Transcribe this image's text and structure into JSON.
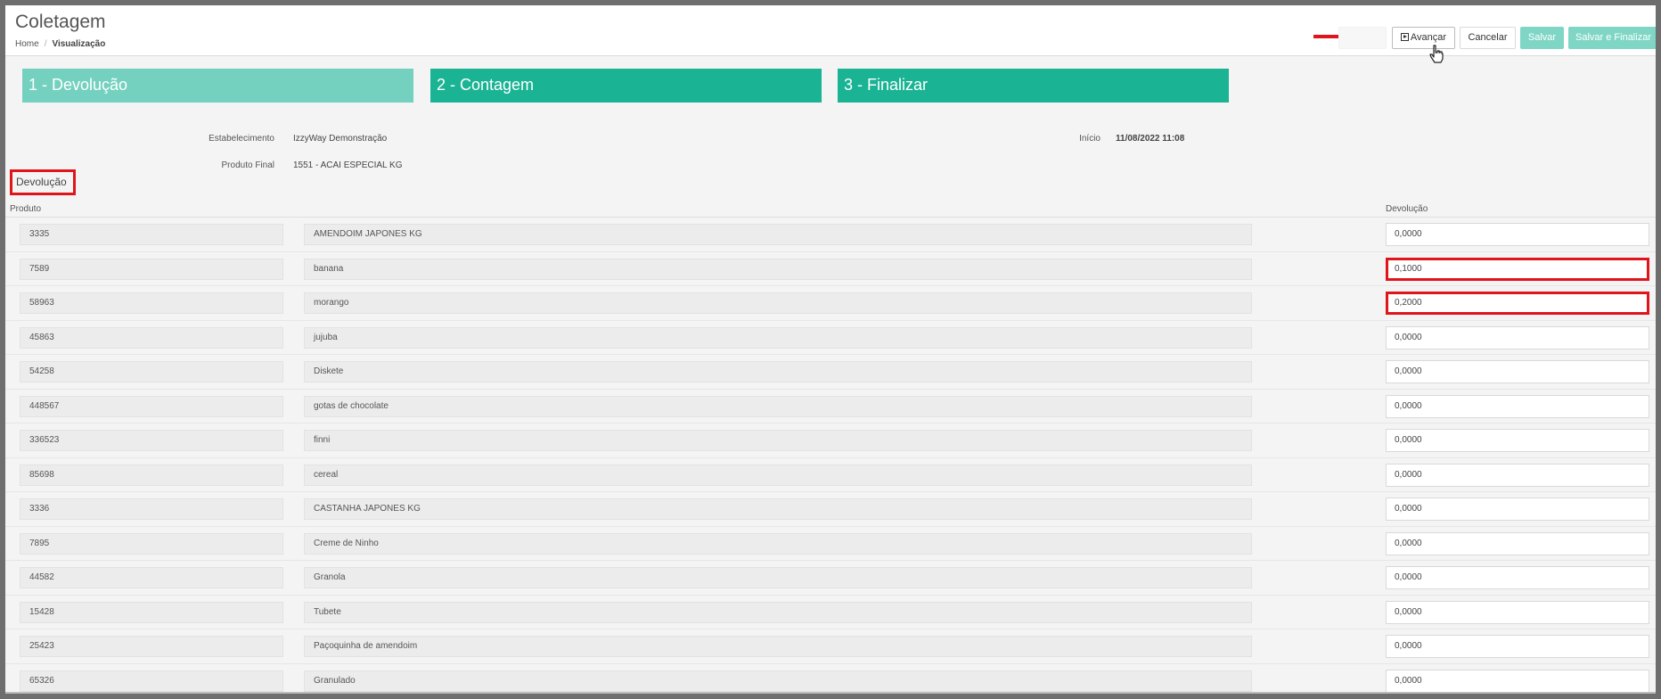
{
  "header": {
    "title": "Coletagem",
    "breadcrumb": {
      "home": "Home",
      "separator": "/",
      "current": "Visualização"
    },
    "buttons": {
      "avancar": "Avançar",
      "cancelar": "Cancelar",
      "salvar": "Salvar",
      "salvar_finalizar": "Salvar e Finalizar"
    }
  },
  "steps": [
    {
      "label": "1 - Devolução",
      "state": "current"
    },
    {
      "label": "2 - Contagem",
      "state": "pending"
    },
    {
      "label": "3 - Finalizar",
      "state": "pending"
    }
  ],
  "info": {
    "estabelecimento_label": "Estabelecimento",
    "estabelecimento_value": "IzzyWay Demonstração",
    "inicio_label": "Início",
    "inicio_value": "11/08/2022 11:08",
    "produto_final_label": "Produto Final",
    "produto_final_value": "1551 - ACAI ESPECIAL KG"
  },
  "section": {
    "title": "Devolução",
    "col_produto": "Produto",
    "col_devolucao": "Devolução"
  },
  "rows": [
    {
      "code": "3335",
      "name": "AMENDOIM JAPONES KG",
      "qty": "0,0000"
    },
    {
      "code": "7589",
      "name": "banana",
      "qty": "0,1000"
    },
    {
      "code": "58963",
      "name": "morango",
      "qty": "0,2000"
    },
    {
      "code": "45863",
      "name": "jujuba",
      "qty": "0,0000"
    },
    {
      "code": "54258",
      "name": "Diskete",
      "qty": "0,0000"
    },
    {
      "code": "448567",
      "name": "gotas de chocolate",
      "qty": "0,0000"
    },
    {
      "code": "336523",
      "name": "finni",
      "qty": "0,0000"
    },
    {
      "code": "85698",
      "name": "cereal",
      "qty": "0,0000"
    },
    {
      "code": "3336",
      "name": "CASTANHA JAPONES KG",
      "qty": "0,0000"
    },
    {
      "code": "7895",
      "name": "Creme de Ninho",
      "qty": "0,0000"
    },
    {
      "code": "44582",
      "name": "Granola",
      "qty": "0,0000"
    },
    {
      "code": "15428",
      "name": "Tubete",
      "qty": "0,0000"
    },
    {
      "code": "25423",
      "name": "Paçoquinha de amendoim",
      "qty": "0,0000"
    },
    {
      "code": "65326",
      "name": "Granulado",
      "qty": "0,0000"
    }
  ],
  "colors": {
    "accent": "#1ab394",
    "accent_light": "#74d1bf",
    "highlight": "#e0141b"
  }
}
